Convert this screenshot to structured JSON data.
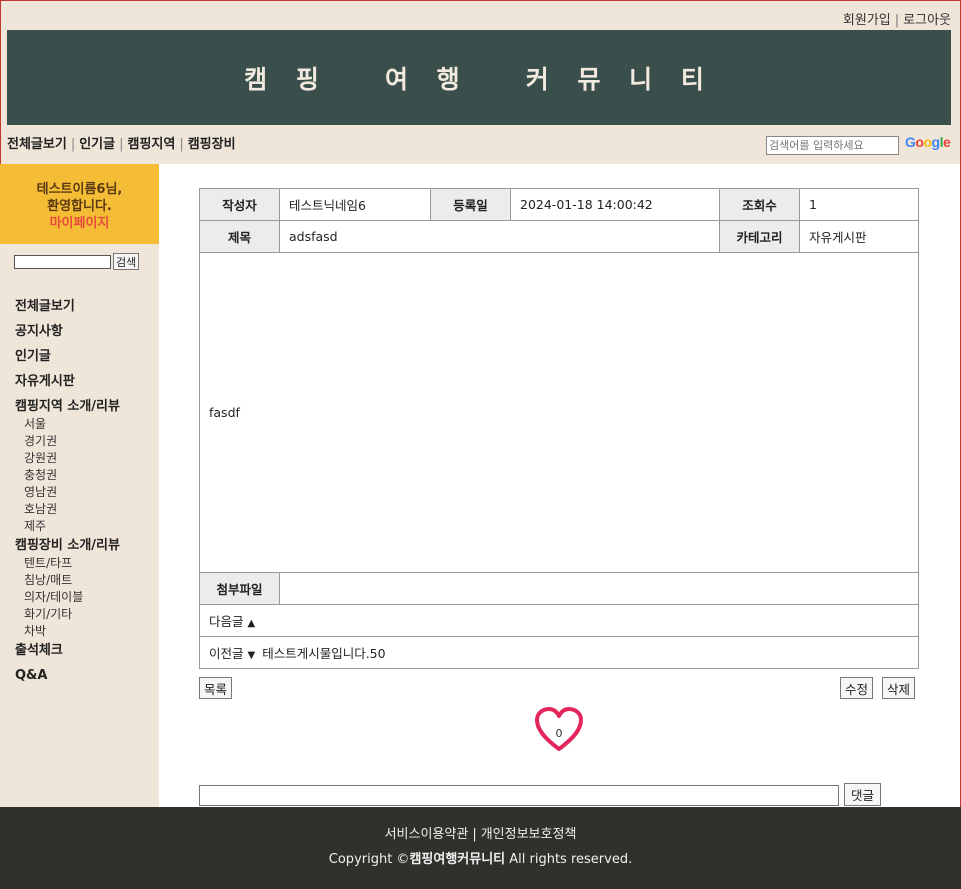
{
  "header": {
    "join": "회원가입",
    "logout": "로그아웃",
    "title": "캠 핑   여 행   커 뮤 니 티"
  },
  "nav": {
    "items": [
      "전체글보기",
      "인기글",
      "캠핑지역",
      "캠핑장비"
    ],
    "search_placeholder": "검색어를 입력하세요",
    "google": [
      "G",
      "o",
      "o",
      "g",
      "l",
      "e"
    ]
  },
  "sidebar": {
    "welcome_line1": "테스트이름6님,",
    "welcome_line2": "환영합니다.",
    "mypage": "마이페이지",
    "search_button": "검색",
    "menu": {
      "all": "전체글보기",
      "notice": "공지사항",
      "popular": "인기글",
      "free": "자유게시판",
      "region": "캠핑지역 소개/리뷰",
      "regions": [
        "서울",
        "경기권",
        "강원권",
        "충청권",
        "영남권",
        "호남권",
        "제주"
      ],
      "gear": "캠핑장비 소개/리뷰",
      "gears": [
        "텐트/타프",
        "침낭/매트",
        "의자/테이블",
        "화기/기타",
        "차박"
      ],
      "attendance": "출석체크",
      "qna": "Q&A"
    }
  },
  "post": {
    "author_label": "작성자",
    "author": "테스트닉네임6",
    "date_label": "등록일",
    "date": "2024-01-18 14:00:42",
    "views_label": "조회수",
    "views": "1",
    "title_label": "제목",
    "title": "adsfasd",
    "category_label": "카테고리",
    "category": "자유게시판",
    "body": "fasdf",
    "attach_label": "첨부파일",
    "attach": "",
    "next_label": "다음글",
    "next_arrow": "▲",
    "next_title": "",
    "prev_label": "이전글",
    "prev_arrow": "▼",
    "prev_title": "테스트게시물입니다.50"
  },
  "actions": {
    "list": "목록",
    "edit": "수정",
    "delete": "삭제",
    "like_count": "0",
    "like_color": "#e3265b",
    "comment_button": "댓글"
  },
  "footer": {
    "terms": "서비스이용약관",
    "privacy": "개인정보보호정책",
    "copyright_prefix": "Copyright ©",
    "brand": "캠핑여행커뮤니티",
    "copyright_suffix": " All rights reserved."
  }
}
